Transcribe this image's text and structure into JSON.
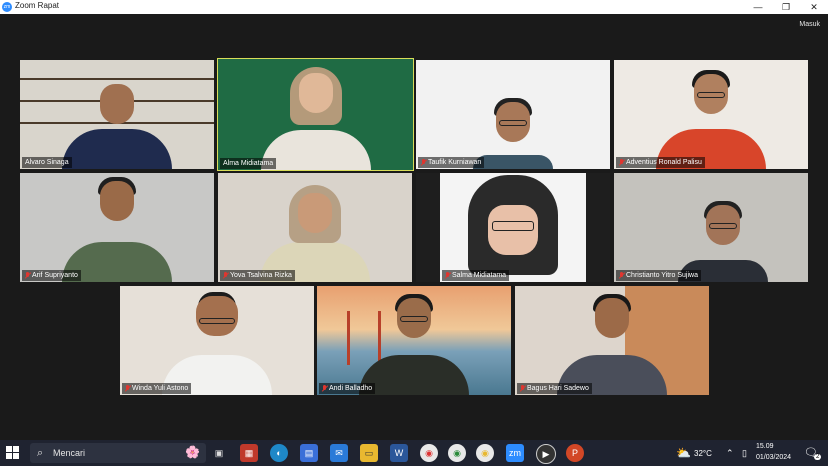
{
  "window": {
    "title": "Zoom Rapat",
    "app_logo": "zm",
    "minimize": "—",
    "restore": "❐",
    "close": "✕"
  },
  "signin_label": "Masuk",
  "participants": [
    {
      "name": "Alvaro Sinaga",
      "muted": false,
      "active_speaker": false
    },
    {
      "name": "Alma Midiatama",
      "muted": false,
      "active_speaker": true
    },
    {
      "name": "Taufik Kurniawan",
      "muted": true,
      "active_speaker": false
    },
    {
      "name": "Adventius Ronald Palisu",
      "muted": true,
      "active_speaker": false
    },
    {
      "name": "Arif Supriyanto",
      "muted": true,
      "active_speaker": false
    },
    {
      "name": "Yova Tsalvina Rizka",
      "muted": true,
      "active_speaker": false
    },
    {
      "name": "Salma Midiatama",
      "muted": true,
      "active_speaker": false
    },
    {
      "name": "Christianto Yitro Sujiwa",
      "muted": true,
      "active_speaker": false
    },
    {
      "name": "Winda Yuli Astono",
      "muted": true,
      "active_speaker": false
    },
    {
      "name": "Andi Balladho",
      "muted": true,
      "active_speaker": false
    },
    {
      "name": "Bagus Hari Sadewo",
      "muted": true,
      "active_speaker": false
    }
  ],
  "taskbar": {
    "search_placeholder": "Mencari",
    "apps": [
      "gift",
      "edge",
      "store",
      "mail",
      "explorer",
      "word",
      "chrome",
      "chrome-2",
      "chrome-3",
      "zoom",
      "media-player",
      "powerpoint"
    ],
    "zoom_label": "zm",
    "word_label": "W",
    "ppt_label": "P",
    "temperature": "32°C",
    "time": "15.09",
    "date": "01/03/2024",
    "notifications": "2"
  },
  "colors": {
    "active_speaker_border": "#d9dd59",
    "muted_icon": "#e0362f",
    "taskbar": "#1f2330"
  }
}
